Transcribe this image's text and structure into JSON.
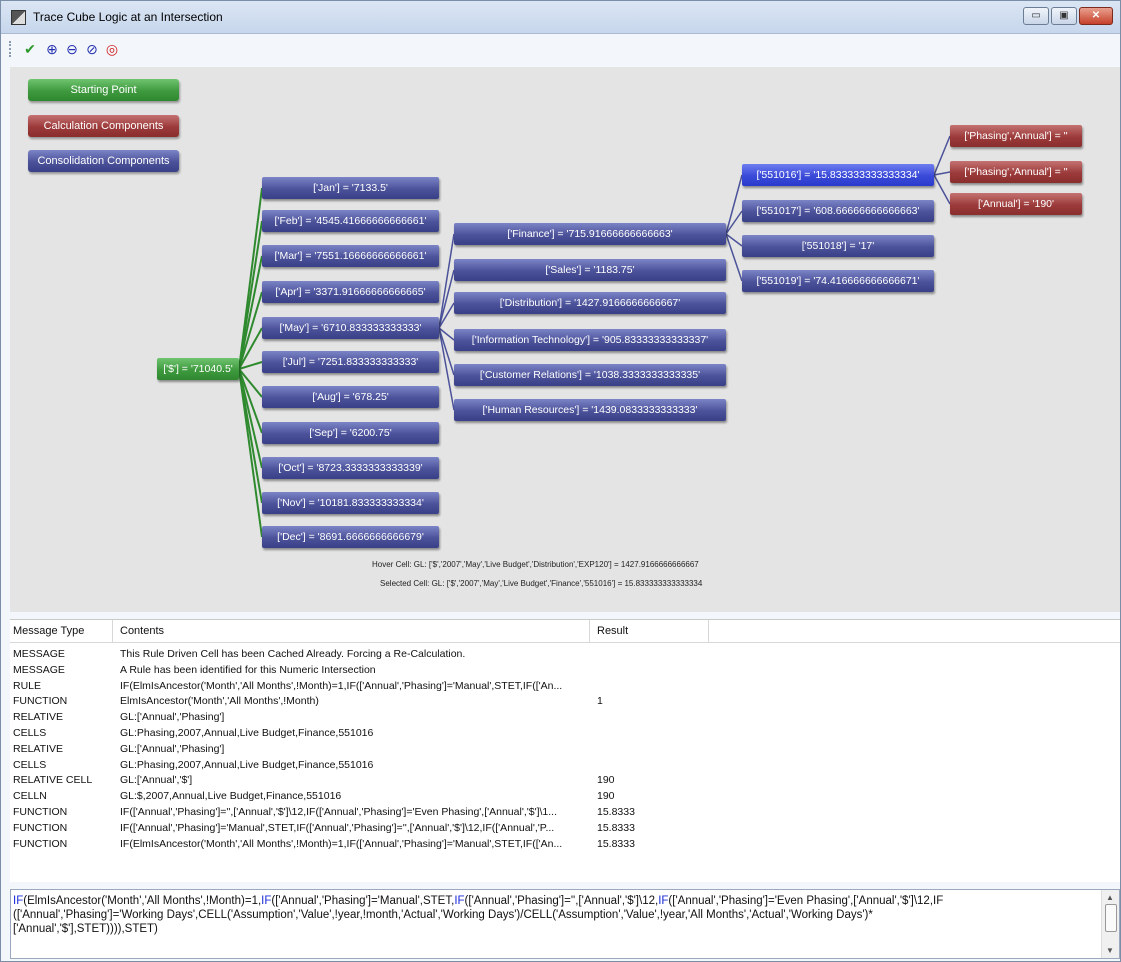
{
  "window": {
    "title": "Trace Cube Logic at an Intersection",
    "minimize_label": "▭",
    "maximize_label": "▣",
    "close_label": "✕"
  },
  "toolbar": {
    "tools": [
      {
        "name": "check-icon",
        "glyph": "✔"
      },
      {
        "name": "zoom-in-icon",
        "glyph": "⊕"
      },
      {
        "name": "zoom-out-icon",
        "glyph": "⊖"
      },
      {
        "name": "zoom-fit-icon",
        "glyph": "⊘"
      },
      {
        "name": "target-icon",
        "glyph": "◎"
      }
    ]
  },
  "legend": {
    "starting_point": "Starting Point",
    "calculation_components": "Calculation Components",
    "consolidation_components": "Consolidation Components"
  },
  "tree": {
    "root": "['$'] = '71040.5'",
    "months": [
      "['Jan'] = '7133.5'",
      "['Feb'] = '4545.41666666666661'",
      "['Mar'] = '7551.16666666666661'",
      "['Apr'] = '3371.91666666666665'",
      "['May'] = '6710.833333333333'",
      "['Jul'] = '7251.833333333333'",
      "['Aug'] = '678.25'",
      "['Sep'] = '6200.75'",
      "['Oct'] = '8723.3333333333339'",
      "['Nov'] = '10181.833333333334'",
      "['Dec'] = '8691.6666666666679'"
    ],
    "departments": [
      "['Finance'] = '715.91666666666663'",
      "['Sales'] = '1183.75'",
      "['Distribution'] = '1427.9166666666667'",
      "['Information Technology'] = '905.83333333333337'",
      "['Customer Relations'] = '1038.3333333333335'",
      "['Human Resources'] = '1439.0833333333333'"
    ],
    "accounts": [
      "['551016'] = '15.833333333333334'",
      "['551017'] = '608.66666666666663'",
      "['551018'] = '17'",
      "['551019'] = '74.416666666666671'"
    ],
    "calculations": [
      "['Phasing','Annual'] = ''",
      "['Phasing','Annual'] = ''",
      "['Annual'] = '190'"
    ]
  },
  "status": {
    "hover": "Hover Cell: GL: ['$','2007','May','Live Budget','Distribution','EXP120'] = 1427.9166666666667",
    "selected": "Selected Cell: GL: ['$','2007','May','Live Budget','Finance','551016'] = 15.833333333333334"
  },
  "messages": {
    "headers": {
      "type": "Message Type",
      "contents": "Contents",
      "result": "Result"
    },
    "rows": [
      {
        "type": "MESSAGE",
        "contents": "This Rule Driven Cell has been Cached Already. Forcing a Re-Calculation.",
        "result": ""
      },
      {
        "type": "MESSAGE",
        "contents": "A Rule has been identified for this Numeric Intersection",
        "result": ""
      },
      {
        "type": "RULE",
        "contents": "IF(ElmIsAncestor('Month','All Months',!Month)=1,IF(['Annual','Phasing']='Manual',STET,IF(['An...",
        "result": ""
      },
      {
        "type": "FUNCTION",
        "contents": "ElmIsAncestor('Month','All Months',!Month)",
        "result": "1"
      },
      {
        "type": "RELATIVE",
        "contents": "GL:['Annual','Phasing']",
        "result": ""
      },
      {
        "type": "CELLS",
        "contents": "GL:Phasing,2007,Annual,Live Budget,Finance,551016",
        "result": ""
      },
      {
        "type": "RELATIVE",
        "contents": "GL:['Annual','Phasing']",
        "result": ""
      },
      {
        "type": "CELLS",
        "contents": "GL:Phasing,2007,Annual,Live Budget,Finance,551016",
        "result": ""
      },
      {
        "type": "RELATIVE CELL",
        "contents": "GL:['Annual','$']",
        "result": "190"
      },
      {
        "type": "CELLN",
        "contents": "GL:$,2007,Annual,Live Budget,Finance,551016",
        "result": "190"
      },
      {
        "type": "FUNCTION",
        "contents": "IF(['Annual','Phasing']='',['Annual','$']\\12,IF(['Annual','Phasing']='Even Phasing',['Annual','$']\\1...",
        "result": "15.8333"
      },
      {
        "type": "FUNCTION",
        "contents": "IF(['Annual','Phasing']='Manual',STET,IF(['Annual','Phasing']='',['Annual','$']\\12,IF(['Annual','P...",
        "result": "15.8333"
      },
      {
        "type": "FUNCTION",
        "contents": "IF(ElmIsAncestor('Month','All Months',!Month)=1,IF(['Annual','Phasing']='Manual',STET,IF(['An...",
        "result": "15.8333"
      }
    ]
  },
  "editor": {
    "lines": [
      "IF(ElmIsAncestor('Month','All Months',!Month)=1,IF(['Annual','Phasing']='Manual',STET,IF(['Annual','Phasing']='',['Annual','$']\\12,IF(['Annual','Phasing']='Even Phasing',['Annual','$']\\12,IF",
      "(['Annual','Phasing']='Working Days',CELL('Assumption','Value',!year,!month,'Actual','Working Days')/CELL('Assumption','Value',!year,'All Months','Actual','Working Days')*",
      "['Annual','$'],STET)))),STET)"
    ]
  },
  "colors": {
    "starting": "#3f9a3f",
    "calculation": "#9c3a3a",
    "consolidation": "#4b5299",
    "selected": "#3a4ad8",
    "link": "#2f8a2f"
  }
}
